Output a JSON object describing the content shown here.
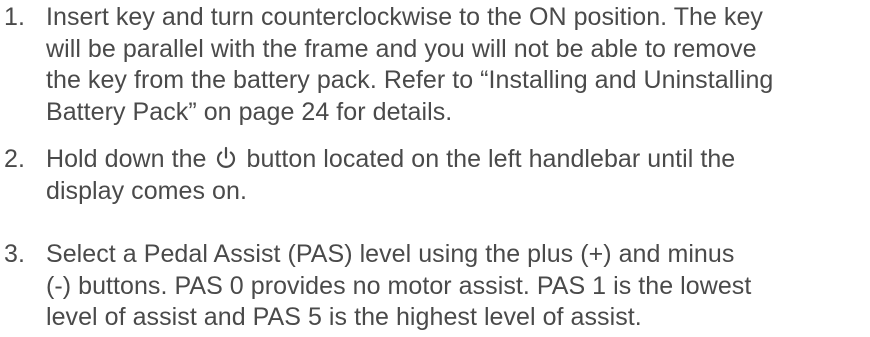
{
  "steps": [
    {
      "number": "1.",
      "lines": [
        "Insert key and turn counterclockwise to the ON position. The key",
        "will be parallel with the frame and you will not be able to remove",
        "the key from the battery pack. Refer to “Installing and Uninstalling",
        "Battery Pack” on page 24 for details."
      ]
    },
    {
      "number": "2.",
      "line1_before_icon": "Hold down the",
      "line1_after_icon": "button located on the left handlebar until the",
      "line2": "display comes on.",
      "icon": "power-icon"
    },
    {
      "number": "3.",
      "lines": [
        "Select a Pedal Assist (PAS) level using the plus (+) and minus",
        "(-) buttons. PAS 0 provides no motor assist. PAS 1 is the lowest",
        "level of assist and PAS 5 is the highest level of assist."
      ]
    }
  ]
}
